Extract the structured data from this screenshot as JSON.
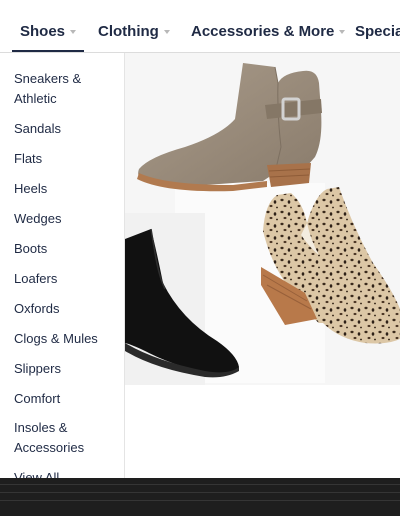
{
  "nav": {
    "tabs": [
      {
        "label": "Shoes",
        "active": true
      },
      {
        "label": "Clothing"
      },
      {
        "label": "Accessories & More"
      },
      {
        "label": "Special"
      }
    ]
  },
  "shoes_menu": {
    "items": [
      "Sneakers & Athletic",
      "Sandals",
      "Flats",
      "Heels",
      "Wedges",
      "Boots",
      "Loafers",
      "Oxfords",
      "Clogs & Mules",
      "Slippers",
      "Comfort",
      "Insoles & Accessories",
      "View All"
    ]
  },
  "colors": {
    "nav_text": "#1f2a44",
    "bootie_taupe": "#9c8e7e",
    "heel_wood": "#a8724a",
    "bootie_black": "#111111",
    "leopard_base": "#d9c4a4"
  }
}
